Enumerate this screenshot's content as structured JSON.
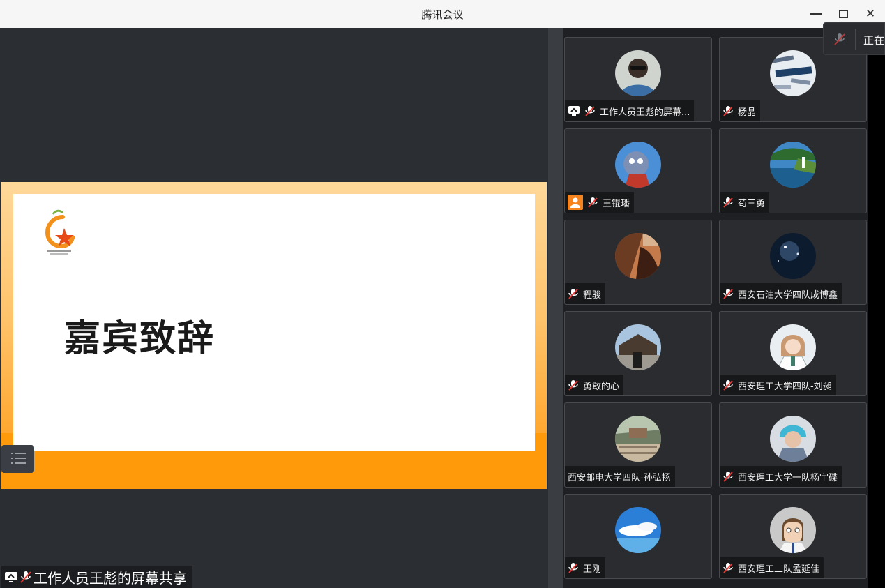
{
  "window": {
    "title": "腾讯会议"
  },
  "share": {
    "slide_title": "嘉宾致辞",
    "label": "工作人员王彪的屏幕共享"
  },
  "speaking_popup": {
    "text": "正在"
  },
  "participants": [
    {
      "name": "工作人员王彪的屏幕...",
      "avatar": "person-sunglasses",
      "muted": true,
      "sharing": true
    },
    {
      "name": "杨晶",
      "avatar": "marketing-words",
      "muted": true
    },
    {
      "name": "王锟璠",
      "avatar": "cartoon-cat",
      "muted": true,
      "host_badge": true
    },
    {
      "name": "苟三勇",
      "avatar": "coast-lighthouse",
      "muted": true
    },
    {
      "name": "程骏",
      "avatar": "canyon-rock",
      "muted": true
    },
    {
      "name": "西安石油大学四队成博鑫",
      "avatar": "night-sky",
      "muted": true
    },
    {
      "name": "勇敢的心",
      "avatar": "person-bridge",
      "muted": true
    },
    {
      "name": "西安理工大学四队-刘昶",
      "avatar": "anime-girl",
      "muted": true
    },
    {
      "name": "西安邮电大学四队-孙弘扬",
      "avatar": "crowd-temple",
      "muted": false
    },
    {
      "name": "西安理工大学一队杨宇碟",
      "avatar": "blue-hair-child",
      "muted": true
    },
    {
      "name": "王刚",
      "avatar": "sky-clouds",
      "muted": true
    },
    {
      "name": "西安理工二队孟延佳",
      "avatar": "cartoon-man",
      "muted": true
    }
  ],
  "colors": {
    "accent_orange": "#ff9a0a",
    "host_badge": "#f5841f"
  }
}
